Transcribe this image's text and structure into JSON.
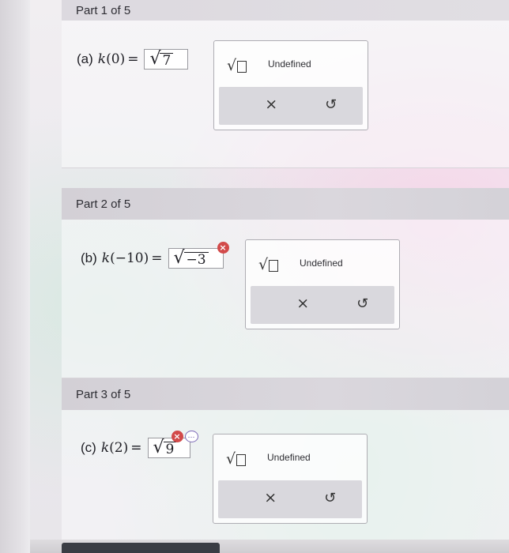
{
  "parts": [
    {
      "header": "Part 1 of 5",
      "label": "(a)",
      "fn": "k",
      "arg": "0",
      "radicand": "7",
      "error": false,
      "more": false
    },
    {
      "header": "Part 2 of 5",
      "label": "(b)",
      "fn": "k",
      "arg": "−10",
      "radicand": "−3",
      "error": true,
      "more": false
    },
    {
      "header": "Part 3 of 5",
      "label": "(c)",
      "fn": "k",
      "arg": "2",
      "radicand": "9",
      "error": true,
      "more": true
    }
  ],
  "palette": {
    "sqrt_symbol": "√",
    "undefined_label": "Undefined",
    "clear_symbol": "×",
    "undo_symbol": "↺"
  },
  "icons": {
    "error": "×",
    "more": "…"
  },
  "colors": {
    "error": "#d24a4a",
    "more": "#7e6bb8"
  }
}
